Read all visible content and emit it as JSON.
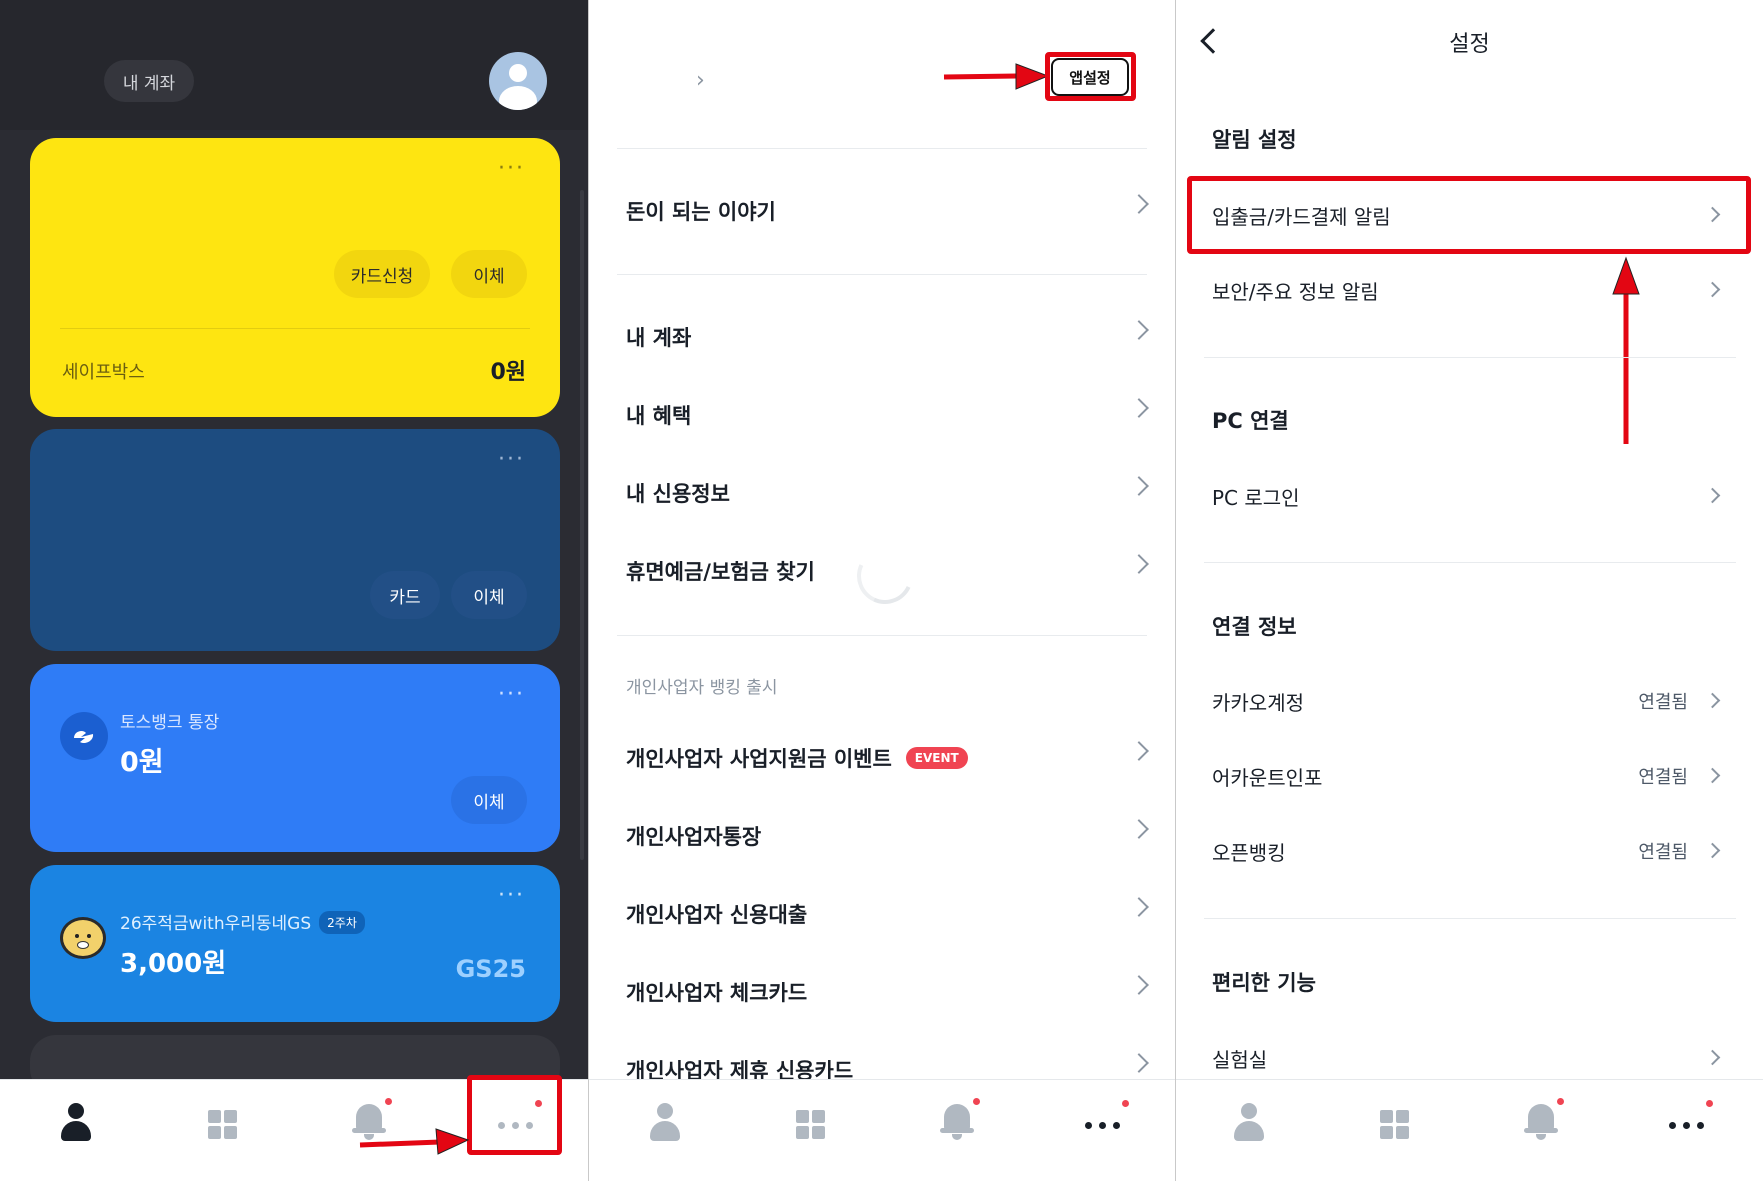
{
  "panel1": {
    "account_pill": "내 계좌",
    "cards": {
      "safebox": {
        "more": "···",
        "btn_card_apply": "카드신청",
        "btn_transfer": "이체",
        "name": "세이프박스",
        "balance": "0원"
      },
      "navy": {
        "more": "···",
        "btn_card": "카드",
        "btn_transfer": "이체"
      },
      "toss": {
        "more": "···",
        "name": "토스뱅크 통장",
        "balance": "0원",
        "btn_transfer": "이체"
      },
      "savings": {
        "more": "···",
        "name": "26주적금with우리동네GS",
        "badge": "2주차",
        "balance": "3,000원",
        "brand": "GS25"
      }
    }
  },
  "panel2": {
    "app_settings_button": "앱설정",
    "menu": [
      "돈이 되는 이야기",
      "내 계좌",
      "내 혜택",
      "내 신용정보",
      "휴면예금/보험금 찾기"
    ],
    "section_caption": "개인사업자 뱅킹 출시",
    "business_menu": [
      "개인사업자 사업지원금 이벤트",
      "개인사업자통장",
      "개인사업자 신용대출",
      "개인사업자 체크카드",
      "개인사업자 제휴 신용카드"
    ],
    "event_badge": "EVENT"
  },
  "panel3": {
    "title": "설정",
    "sections": {
      "alerts": {
        "heading": "알림 설정",
        "items": [
          "입출금/카드결제 알림",
          "보안/주요 정보 알림"
        ]
      },
      "pc": {
        "heading": "PC 연결",
        "items": [
          "PC 로그인"
        ]
      },
      "links": {
        "heading": "연결 정보",
        "items": [
          {
            "label": "카카오계정",
            "value": "연결됨"
          },
          {
            "label": "어카운트인포",
            "value": "연결됨"
          },
          {
            "label": "오픈뱅킹",
            "value": "연결됨"
          }
        ]
      },
      "convenience": {
        "heading": "편리한 기능",
        "items": [
          "실험실"
        ]
      }
    }
  },
  "icons": [
    "person-icon",
    "grid-icon",
    "bell-icon",
    "more-icon",
    "chevron-right-icon",
    "back-arrow-icon"
  ],
  "colors": {
    "accent_yellow": "#fee511",
    "navy": "#1d4c80",
    "toss_blue": "#2f7cf6",
    "highlight_red": "#e30613",
    "dark_bg": "#2b2c33"
  }
}
